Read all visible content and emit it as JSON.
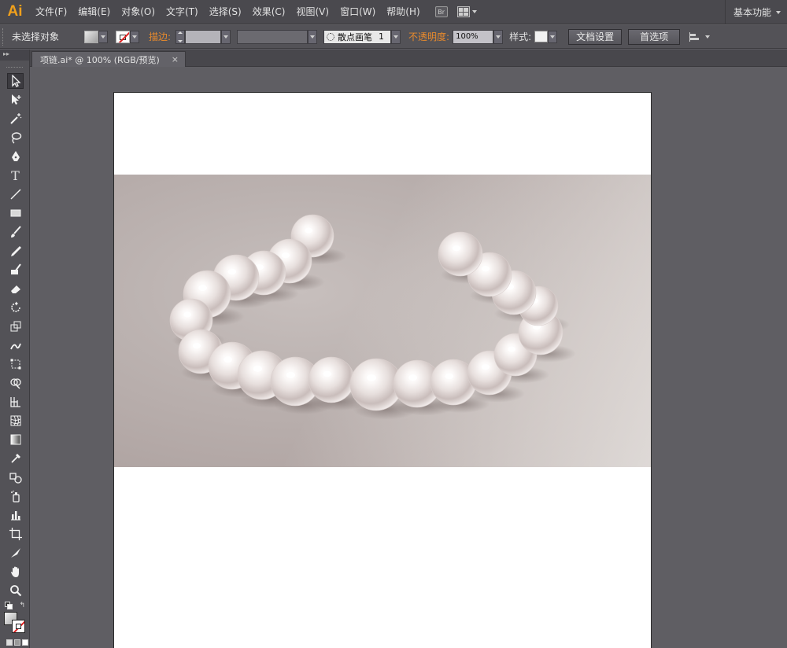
{
  "app": {
    "logo": "Ai",
    "menus": [
      "文件(F)",
      "编辑(E)",
      "对象(O)",
      "文字(T)",
      "选择(S)",
      "效果(C)",
      "视图(V)",
      "窗口(W)",
      "帮助(H)"
    ],
    "bridge_icon": "bridge-icon",
    "bridge_label": "Br",
    "workspace": "基本功能"
  },
  "control_bar": {
    "selection_status": "未选择对象",
    "stroke_label": "描边:",
    "brush_label": "散点画笔",
    "brush_size": "1",
    "opacity_label": "不透明度:",
    "opacity_value": "100%",
    "style_label": "样式:",
    "doc_setup_button": "文档设置",
    "preferences_button": "首选项"
  },
  "document_tab": {
    "title": "项链.ai* @ 100% (RGB/预览)",
    "close": "×"
  },
  "tools": [
    {
      "name": "selection-tool",
      "active": true
    },
    {
      "name": "direct-selection-tool"
    },
    {
      "name": "magic-wand-tool"
    },
    {
      "name": "lasso-tool"
    },
    {
      "name": "pen-tool"
    },
    {
      "name": "type-tool",
      "glyph": "T"
    },
    {
      "name": "line-tool"
    },
    {
      "name": "rectangle-tool"
    },
    {
      "name": "paintbrush-tool"
    },
    {
      "name": "pencil-tool"
    },
    {
      "name": "blob-brush-tool"
    },
    {
      "name": "eraser-tool"
    },
    {
      "name": "rotate-tool"
    },
    {
      "name": "scale-tool"
    },
    {
      "name": "warp-tool"
    },
    {
      "name": "free-transform-tool"
    },
    {
      "name": "shape-builder-tool"
    },
    {
      "name": "perspective-grid-tool"
    },
    {
      "name": "mesh-tool"
    },
    {
      "name": "gradient-tool"
    },
    {
      "name": "eyedropper-tool"
    },
    {
      "name": "blend-tool"
    },
    {
      "name": "symbol-sprayer-tool"
    },
    {
      "name": "column-graph-tool"
    },
    {
      "name": "artboard-tool"
    },
    {
      "name": "slice-tool"
    },
    {
      "name": "hand-tool"
    },
    {
      "name": "zoom-tool"
    }
  ],
  "colors": {
    "accent_orange": "#e88a2c",
    "logo_orange": "#f0a01c",
    "pearl_base": "#ece6e4",
    "background_tint": "#b9afad"
  }
}
